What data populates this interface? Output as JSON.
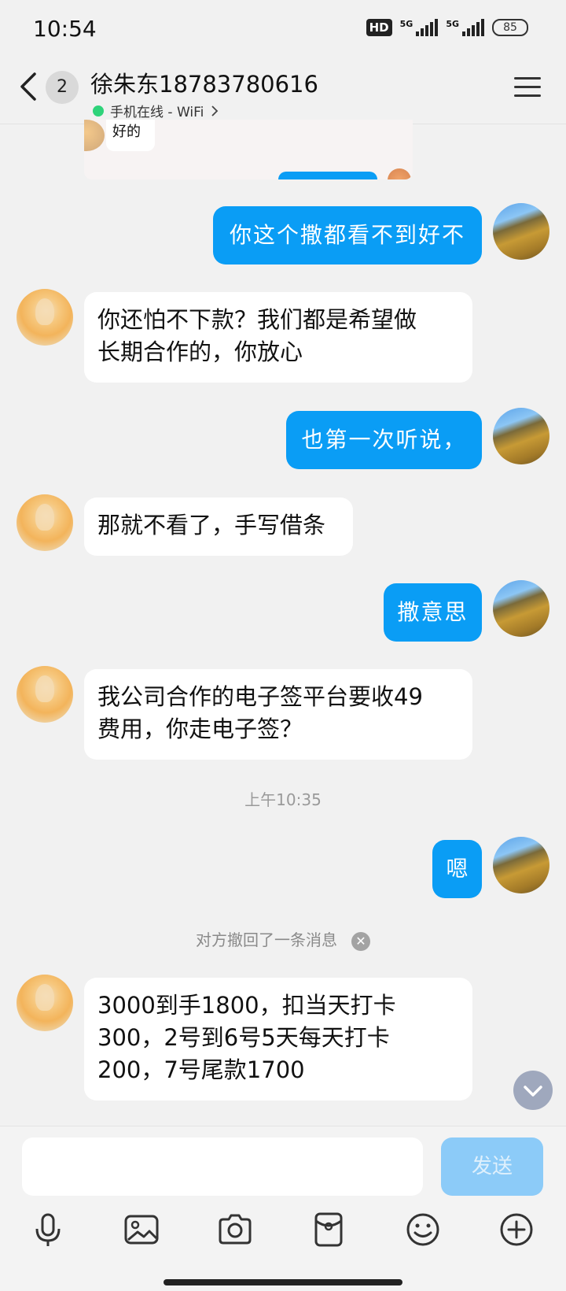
{
  "status_bar": {
    "time": "10:54",
    "hd_label": "HD",
    "network_1": "5G",
    "network_2": "5G",
    "battery": "85"
  },
  "header": {
    "back_icon": "chevron-left-icon",
    "unread_count": "2",
    "contact_name": "徐朱东18783780616",
    "online_status": "手机在线 - WiFi",
    "status_color": "#2ed37a",
    "menu_icon": "menu-icon"
  },
  "quoted": {
    "text": "好的"
  },
  "messages": [
    {
      "side": "out",
      "text": "你这个撒都看不到好不"
    },
    {
      "side": "in",
      "text": "你还怕不下款？我们都是希望做\n长期合作的，你放心"
    },
    {
      "side": "out",
      "text": "也第一次听说，"
    },
    {
      "side": "in",
      "text": "那就不看了，手写借条"
    },
    {
      "side": "out",
      "text": "撒意思"
    },
    {
      "side": "in",
      "text": "我公司合作的电子签平台要收49\n费用，你走电子签？"
    },
    {
      "side": "out",
      "text": "嗯"
    },
    {
      "side": "in",
      "text": "3000到手1800，扣当天打卡\n300，2号到6号5天每天打卡\n200，7号尾款1700"
    }
  ],
  "timestamp": "上午10:35",
  "recall_notice": "对方撤回了一条消息",
  "input": {
    "placeholder": "",
    "send_label": "发送"
  },
  "toolbar": {
    "icons": [
      "microphone-icon",
      "image-icon",
      "camera-icon",
      "red-packet-icon",
      "emoji-icon",
      "plus-icon"
    ]
  },
  "colors": {
    "outgoing_bubble": "#0a9df5",
    "incoming_bubble": "#ffffff",
    "background": "#f1f1f1",
    "send_button": "#8ccbf8"
  }
}
